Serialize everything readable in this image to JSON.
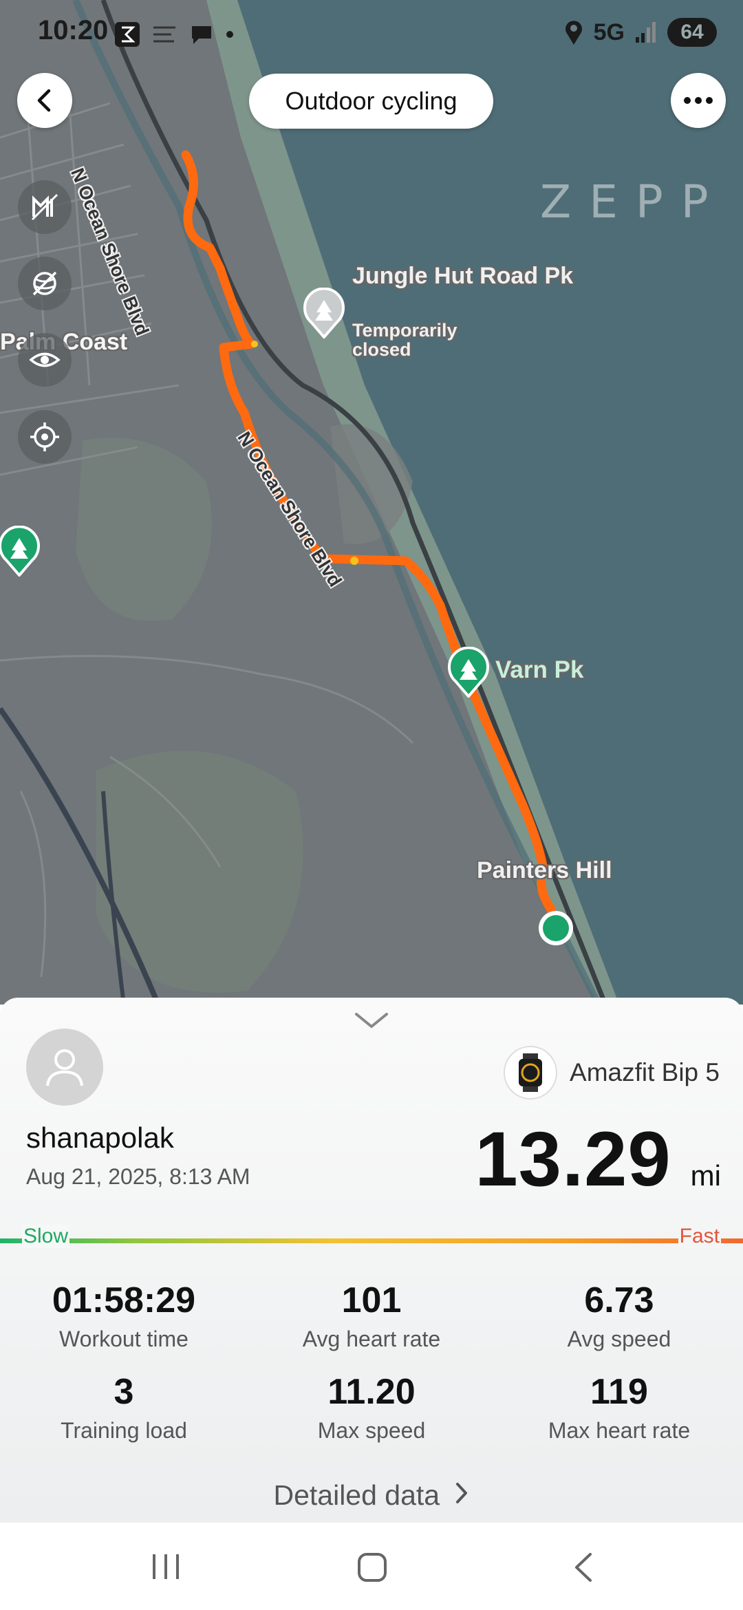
{
  "status_bar": {
    "time": "10:20",
    "network": "5G",
    "battery": "64"
  },
  "header": {
    "title": "Outdoor cycling"
  },
  "map": {
    "brand": "ZEPP",
    "labels": {
      "palm_coast": "Palm Coast",
      "jungle_hut_name": "Jungle Hut Road Pk",
      "jungle_hut_status": "Temporarily closed",
      "varn_pk": "Varn Pk",
      "painters_hill": "Painters Hill",
      "road_1": "N Ocean Shore Blvd",
      "road_2": "N Ocean Shore Blvd"
    },
    "colors": {
      "route": "#ff6a10",
      "ocean": "#4f6d76",
      "land": "#6f7578",
      "park": "#1aa36a"
    }
  },
  "workout": {
    "username": "shanapolak",
    "date": "Aug 21, 2025, 8:13 AM",
    "device": "Amazfit Bip 5",
    "distance": "13.29",
    "distance_unit": "mi",
    "speed_scale": {
      "slow": "Slow",
      "fast": "Fast"
    },
    "stats": [
      {
        "value": "01:58:29",
        "label": "Workout time"
      },
      {
        "value": "101",
        "label": "Avg heart rate"
      },
      {
        "value": "6.73",
        "label": "Avg speed"
      },
      {
        "value": "3",
        "label": "Training load"
      },
      {
        "value": "11.20",
        "label": "Max speed"
      },
      {
        "value": "119",
        "label": "Max heart rate"
      }
    ],
    "detailed_label": "Detailed data"
  }
}
